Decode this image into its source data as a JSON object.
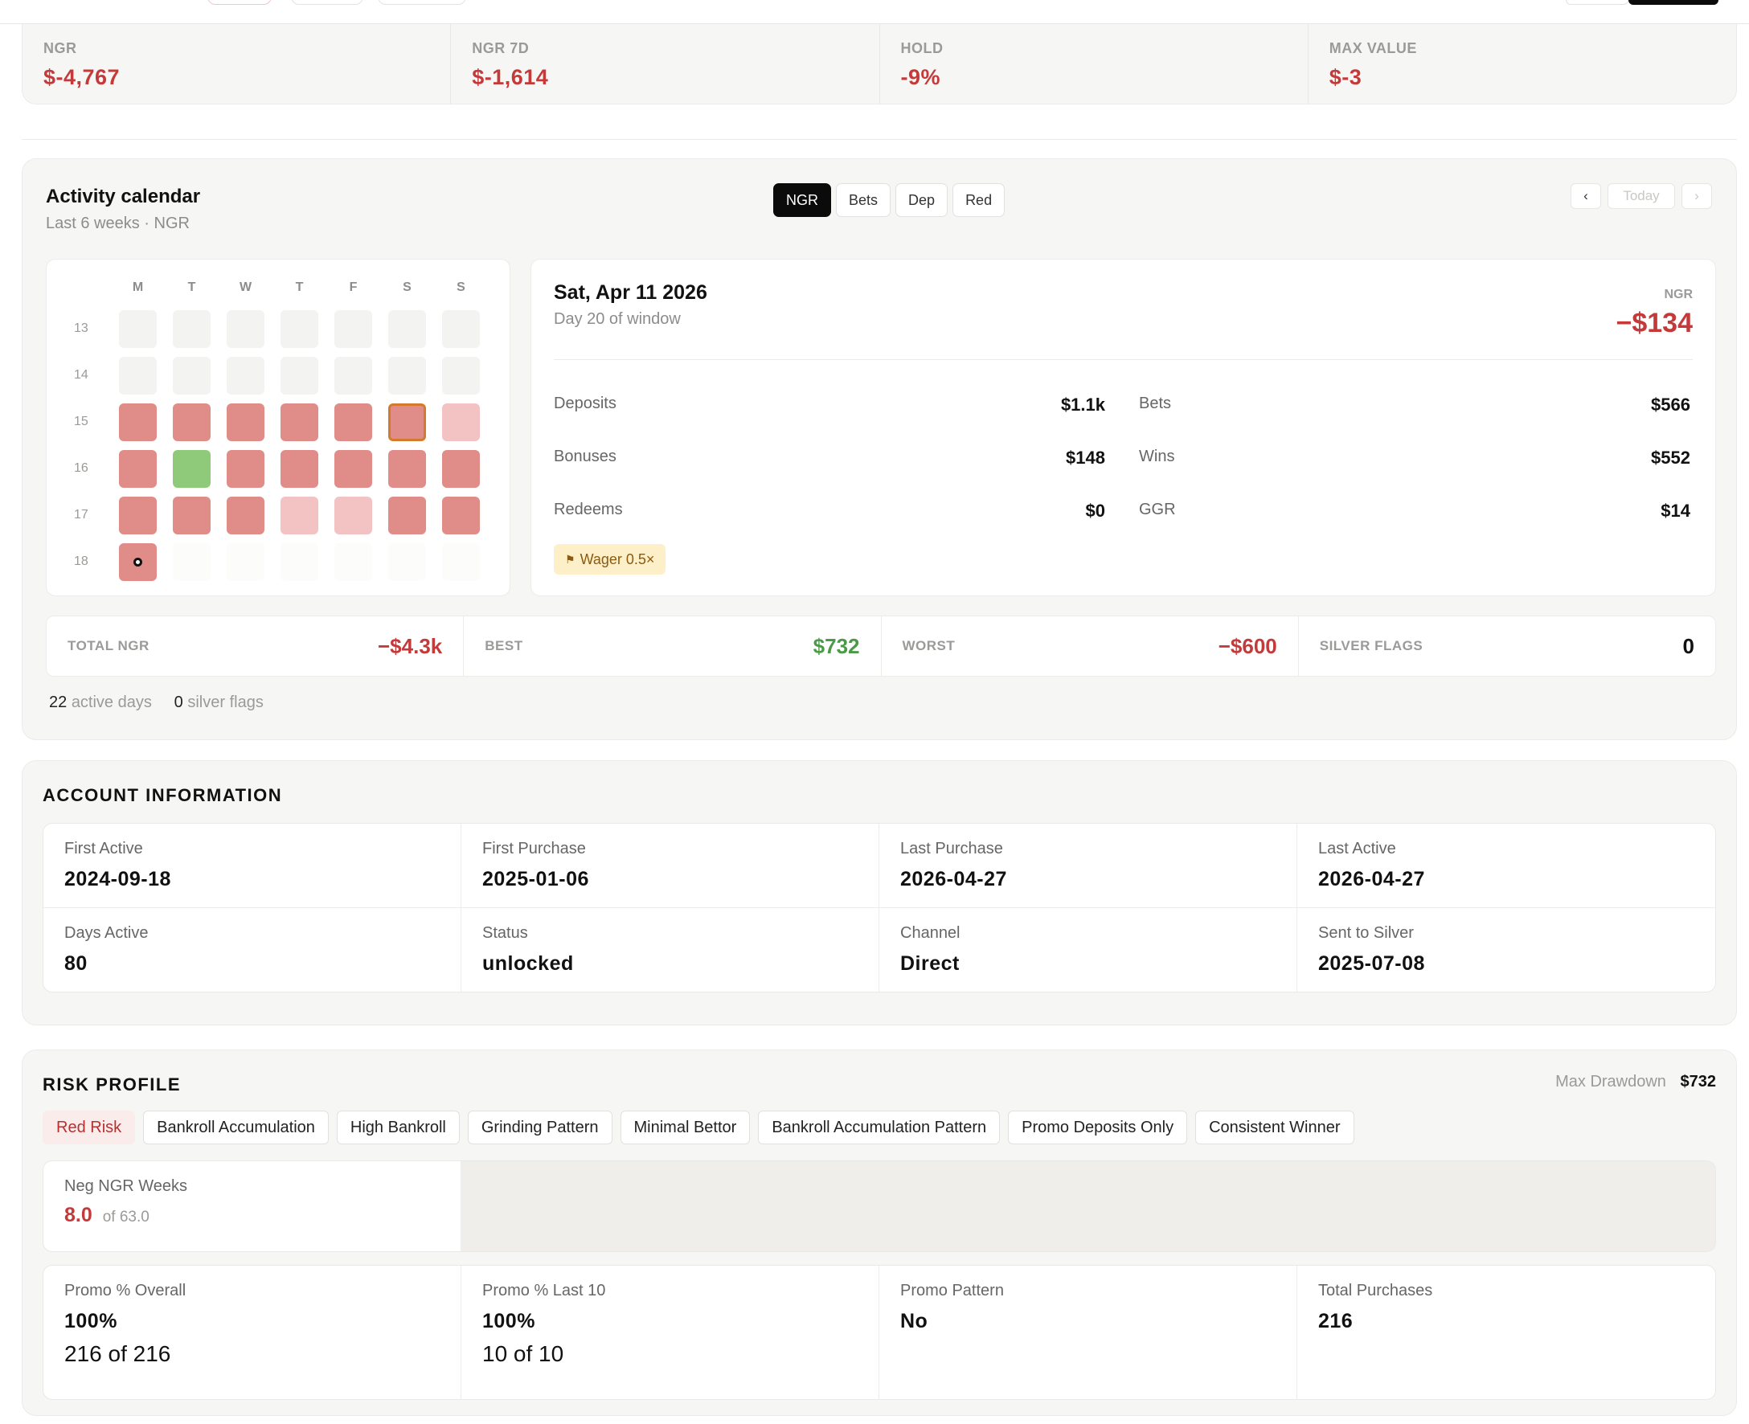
{
  "kpis": [
    {
      "label": "NGR",
      "value": "$-4,767"
    },
    {
      "label": "NGR 7D",
      "value": "$-1,614"
    },
    {
      "label": "HOLD",
      "value": "-9%"
    },
    {
      "label": "MAX VALUE",
      "value": "$-3"
    }
  ],
  "activity": {
    "title": "Activity calendar",
    "subtitle": "Last 6 weeks · NGR",
    "segments": [
      "NGR",
      "Bets",
      "Dep",
      "Red"
    ],
    "active_segment": "NGR",
    "nav": {
      "prev": "‹",
      "today": "Today",
      "next": "›"
    },
    "weekdays": [
      "M",
      "T",
      "W",
      "T",
      "F",
      "S",
      "S"
    ],
    "weeks": [
      "13",
      "14",
      "15",
      "16",
      "17",
      "18"
    ],
    "grid": [
      [
        "none",
        "none",
        "none",
        "none",
        "none",
        "none",
        "none"
      ],
      [
        "none",
        "none",
        "none",
        "none",
        "none",
        "none",
        "none"
      ],
      [
        "neg",
        "neg",
        "neg",
        "neg",
        "neg",
        "neg",
        "light"
      ],
      [
        "neg",
        "pos",
        "neg",
        "neg",
        "neg",
        "neg",
        "neg"
      ],
      [
        "neg",
        "neg",
        "neg",
        "light",
        "light",
        "neg",
        "neg"
      ],
      [
        "neg",
        "empty",
        "empty",
        "empty",
        "empty",
        "empty",
        "empty"
      ]
    ],
    "selected_day": [
      2,
      5
    ],
    "today_day": [
      5,
      0
    ],
    "detail": {
      "date": "Sat, Apr 11 2026",
      "sub": "Day 20 of window",
      "ngr_label": "NGR",
      "ngr_value": "−$134",
      "metrics": [
        {
          "label": "Deposits",
          "value": "$1.1k"
        },
        {
          "label": "Bets",
          "value": "$566"
        },
        {
          "label": "Bonuses",
          "value": "$148"
        },
        {
          "label": "Wins",
          "value": "$552"
        },
        {
          "label": "Redeems",
          "value": "$0"
        },
        {
          "label": "GGR",
          "value": "$14"
        }
      ],
      "tag": "Wager 0.5×",
      "tag_icon": "flag-icon"
    },
    "summary": [
      {
        "label": "TOTAL NGR",
        "value": "−$4.3k",
        "tone": "red"
      },
      {
        "label": "BEST",
        "value": "$732",
        "tone": "green"
      },
      {
        "label": "WORST",
        "value": "−$600",
        "tone": "red"
      },
      {
        "label": "SILVER FLAGS",
        "value": "0",
        "tone": "dark"
      }
    ],
    "footer": {
      "active_days_count": "22",
      "active_days_label": "active days",
      "silver_flags_count": "0",
      "silver_flags_label": "silver flags"
    }
  },
  "account": {
    "title": "ACCOUNT INFORMATION",
    "cells": [
      {
        "label": "First Active",
        "value": "2024-09-18"
      },
      {
        "label": "First Purchase",
        "value": "2025-01-06"
      },
      {
        "label": "Last Purchase",
        "value": "2026-04-27"
      },
      {
        "label": "Last Active",
        "value": "2026-04-27"
      },
      {
        "label": "Days Active",
        "value": "80"
      },
      {
        "label": "Status",
        "value": "unlocked"
      },
      {
        "label": "Channel",
        "value": "Direct"
      },
      {
        "label": "Sent to Silver",
        "value": "2025-07-08"
      }
    ]
  },
  "risk": {
    "title": "RISK PROFILE",
    "drawdown_label": "Max Drawdown",
    "drawdown_value": "$732",
    "chips": [
      "Red Risk",
      "Bankroll Accumulation",
      "High Bankroll",
      "Grinding Pattern",
      "Minimal Bettor",
      "Bankroll Accumulation Pattern",
      "Promo Deposits Only",
      "Consistent Winner"
    ],
    "neg_weeks": {
      "label": "Neg NGR Weeks",
      "value": "8.0",
      "of": "of 63.0"
    },
    "cells": [
      {
        "label": "Promo % Overall",
        "value": "100%",
        "sub": "216 of 216",
        "tone": "red"
      },
      {
        "label": "Promo % Last 10",
        "value": "100%",
        "sub": "10 of 10",
        "tone": "red"
      },
      {
        "label": "Promo Pattern",
        "value": "No",
        "sub": "",
        "tone": "dark"
      },
      {
        "label": "Total Purchases",
        "value": "216",
        "sub": "",
        "tone": "dark"
      }
    ]
  },
  "colors": {
    "negative": "#c43a3a",
    "positive": "#4a9a48",
    "cell_neg": "#e08d8a",
    "cell_light": "#f2c3c2",
    "cell_pos": "#8fc97a"
  }
}
